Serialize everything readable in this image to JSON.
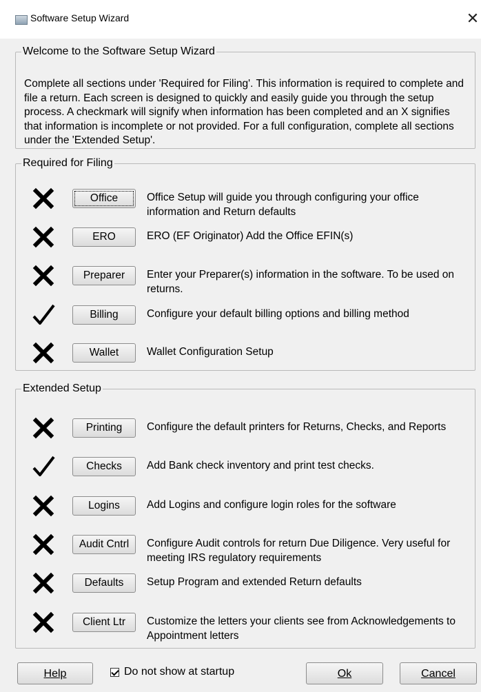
{
  "window": {
    "title": "Software Setup Wizard",
    "close_glyph": "✕"
  },
  "welcome": {
    "legend": "Welcome to the Software Setup Wizard",
    "text": "Complete all sections under 'Required for Filing'. This information is required to complete and file a return. Each screen is designed to quickly and easily guide you through the setup process. A checkmark will signify when information has been completed and an X signifies that information is incomplete or not provided. For a full configuration, complete all sections under the 'Extended Setup'."
  },
  "required": {
    "legend": "Required for Filing",
    "items": [
      {
        "status": "x-icon",
        "label": "Office",
        "description": "Office Setup will guide you through configuring your office information and Return defaults"
      },
      {
        "status": "x-icon",
        "label": "ERO",
        "description": "ERO (EF Originator) Add the Office EFIN(s)"
      },
      {
        "status": "x-icon",
        "label": "Preparer",
        "description": "Enter your Preparer(s) information in the software. To be used on returns."
      },
      {
        "status": "checkmark-icon",
        "label": "Billing",
        "description": "Configure your default billing options and billing method"
      },
      {
        "status": "x-icon",
        "label": "Wallet",
        "description": "Wallet Configuration Setup"
      }
    ]
  },
  "extended": {
    "legend": "Extended Setup",
    "items": [
      {
        "status": "x-icon",
        "label": "Printing",
        "description": "Configure the default printers for Returns, Checks, and Reports"
      },
      {
        "status": "checkmark-icon",
        "label": "Checks",
        "description": "Add Bank check inventory and print test checks."
      },
      {
        "status": "x-icon",
        "label": "Logins",
        "description": "Add Logins and configure login roles for the software"
      },
      {
        "status": "x-icon",
        "label": "Audit Cntrl",
        "description": "Configure Audit controls for return Due Diligence. Very useful for meeting IRS regulatory requirements"
      },
      {
        "status": "x-icon",
        "label": "Defaults",
        "description": "Setup Program and extended Return defaults"
      },
      {
        "status": "x-icon",
        "label": "Client Ltr",
        "description": "Customize the letters your clients see from Acknowledgements to Appointment letters"
      }
    ]
  },
  "footer": {
    "help_label": "Help",
    "startup_label": "Do not show at startup",
    "startup_checked": true,
    "ok_label": "Ok",
    "cancel_label": "Cancel"
  }
}
